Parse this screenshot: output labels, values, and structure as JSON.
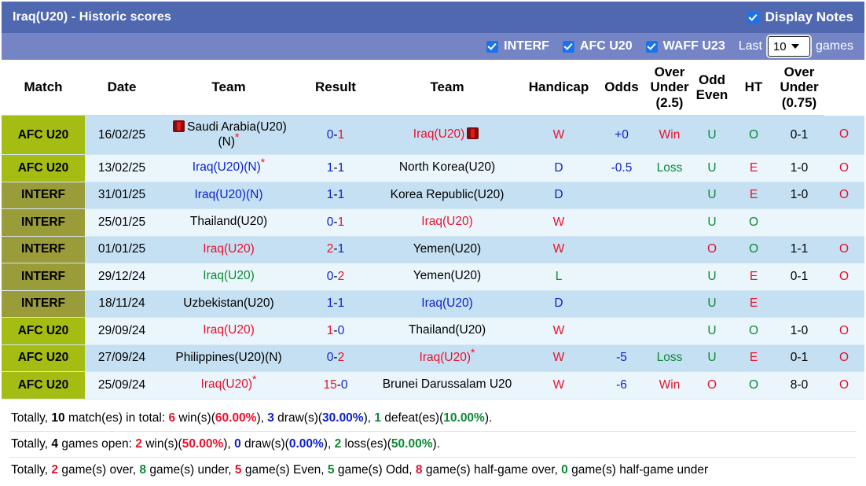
{
  "header": {
    "title": "Iraq(U20) - Historic scores",
    "display_notes_label": "Display Notes"
  },
  "filters": {
    "items": [
      {
        "label": "INTERF",
        "checked": true
      },
      {
        "label": "AFC U20",
        "checked": true
      },
      {
        "label": "WAFF U23",
        "checked": true
      }
    ],
    "last_label": "Last",
    "count_value": "10",
    "games_label": "games"
  },
  "table": {
    "columns": [
      "Match",
      "Date",
      "Team",
      "Result",
      "Team",
      "Handicap",
      "Odds",
      "Over Under (2.5)",
      "Odd Even",
      "HT",
      "Over Under (0.75)"
    ],
    "col_over_under_25": [
      "Over",
      "Under",
      "(2.5)"
    ],
    "col_odd_even": [
      "Odd",
      "Even"
    ],
    "col_over_under_075": [
      "Over",
      "Under",
      "(0.75)"
    ],
    "rows": [
      {
        "league": "AFC U20",
        "league_type": "afc",
        "date": "16/02/25",
        "home": "Saudi Arabia(U20)(N)",
        "home_color": "black",
        "home_card": true,
        "home_star": true,
        "score_left": "0",
        "score_left_color": "blue",
        "score_right": "1",
        "score_right_color": "red",
        "away": "Iraq(U20)",
        "away_color": "red",
        "away_card": true,
        "away_star": false,
        "wdl": "W",
        "wdl_color": "red",
        "handicap": "+0",
        "handicap_color": "blue",
        "odds": "Win",
        "odds_color": "red",
        "ou25": "U",
        "ou25_color": "green",
        "oddeven": "O",
        "oddeven_color": "green",
        "ht": "0-1",
        "ou075": "O",
        "ou075_color": "red",
        "tall": true
      },
      {
        "league": "AFC U20",
        "league_type": "afc",
        "date": "13/02/25",
        "home": "Iraq(U20)(N)",
        "home_color": "blue",
        "home_card": false,
        "home_star": true,
        "score_left": "1",
        "score_left_color": "blue",
        "score_right": "1",
        "score_right_color": "blue",
        "away": "North Korea(U20)",
        "away_color": "black",
        "away_card": false,
        "away_star": false,
        "wdl": "D",
        "wdl_color": "blue",
        "handicap": "-0.5",
        "handicap_color": "blue",
        "odds": "Loss",
        "odds_color": "green",
        "ou25": "U",
        "ou25_color": "green",
        "oddeven": "E",
        "oddeven_color": "red",
        "ht": "1-0",
        "ou075": "O",
        "ou075_color": "red",
        "tall": false
      },
      {
        "league": "INTERF",
        "league_type": "intf",
        "date": "31/01/25",
        "home": "Iraq(U20)(N)",
        "home_color": "blue",
        "home_card": false,
        "home_star": false,
        "score_left": "1",
        "score_left_color": "blue",
        "score_right": "1",
        "score_right_color": "blue",
        "away": "Korea Republic(U20)",
        "away_color": "black",
        "away_card": false,
        "away_star": false,
        "wdl": "D",
        "wdl_color": "blue",
        "handicap": "",
        "handicap_color": "blue",
        "odds": "",
        "odds_color": "red",
        "ou25": "U",
        "ou25_color": "green",
        "oddeven": "E",
        "oddeven_color": "red",
        "ht": "1-0",
        "ou075": "O",
        "ou075_color": "red",
        "tall": false
      },
      {
        "league": "INTERF",
        "league_type": "intf",
        "date": "25/01/25",
        "home": "Thailand(U20)",
        "home_color": "black",
        "home_card": false,
        "home_star": false,
        "score_left": "0",
        "score_left_color": "blue",
        "score_right": "1",
        "score_right_color": "red",
        "away": "Iraq(U20)",
        "away_color": "red",
        "away_card": false,
        "away_star": false,
        "wdl": "W",
        "wdl_color": "red",
        "handicap": "",
        "handicap_color": "blue",
        "odds": "",
        "odds_color": "red",
        "ou25": "U",
        "ou25_color": "green",
        "oddeven": "O",
        "oddeven_color": "green",
        "ht": "",
        "ou075": "",
        "ou075_color": "red",
        "tall": false
      },
      {
        "league": "INTERF",
        "league_type": "intf",
        "date": "01/01/25",
        "home": "Iraq(U20)",
        "home_color": "red",
        "home_card": false,
        "home_star": false,
        "score_left": "2",
        "score_left_color": "red",
        "score_right": "1",
        "score_right_color": "blue",
        "away": "Yemen(U20)",
        "away_color": "black",
        "away_card": false,
        "away_star": false,
        "wdl": "W",
        "wdl_color": "red",
        "handicap": "",
        "handicap_color": "blue",
        "odds": "",
        "odds_color": "red",
        "ou25": "O",
        "ou25_color": "red",
        "oddeven": "O",
        "oddeven_color": "green",
        "ht": "1-1",
        "ou075": "O",
        "ou075_color": "red",
        "tall": false
      },
      {
        "league": "INTERF",
        "league_type": "intf",
        "date": "29/12/24",
        "home": "Iraq(U20)",
        "home_color": "green",
        "home_card": false,
        "home_star": false,
        "score_left": "0",
        "score_left_color": "blue",
        "score_right": "2",
        "score_right_color": "red",
        "away": "Yemen(U20)",
        "away_color": "black",
        "away_card": false,
        "away_star": false,
        "wdl": "L",
        "wdl_color": "green",
        "handicap": "",
        "handicap_color": "blue",
        "odds": "",
        "odds_color": "red",
        "ou25": "U",
        "ou25_color": "green",
        "oddeven": "E",
        "oddeven_color": "red",
        "ht": "0-1",
        "ou075": "O",
        "ou075_color": "red",
        "tall": false
      },
      {
        "league": "INTERF",
        "league_type": "intf",
        "date": "18/11/24",
        "home": "Uzbekistan(U20)",
        "home_color": "black",
        "home_card": false,
        "home_star": false,
        "score_left": "1",
        "score_left_color": "blue",
        "score_right": "1",
        "score_right_color": "blue",
        "away": "Iraq(U20)",
        "away_color": "blue",
        "away_card": false,
        "away_star": false,
        "wdl": "D",
        "wdl_color": "blue",
        "handicap": "",
        "handicap_color": "blue",
        "odds": "",
        "odds_color": "red",
        "ou25": "U",
        "ou25_color": "green",
        "oddeven": "E",
        "oddeven_color": "red",
        "ht": "",
        "ou075": "",
        "ou075_color": "red",
        "tall": false
      },
      {
        "league": "AFC U20",
        "league_type": "afc",
        "date": "29/09/24",
        "home": "Iraq(U20)",
        "home_color": "red",
        "home_card": false,
        "home_star": false,
        "score_left": "1",
        "score_left_color": "red",
        "score_right": "0",
        "score_right_color": "blue",
        "away": "Thailand(U20)",
        "away_color": "black",
        "away_card": false,
        "away_star": false,
        "wdl": "W",
        "wdl_color": "red",
        "handicap": "",
        "handicap_color": "blue",
        "odds": "",
        "odds_color": "red",
        "ou25": "U",
        "ou25_color": "green",
        "oddeven": "O",
        "oddeven_color": "green",
        "ht": "1-0",
        "ou075": "O",
        "ou075_color": "red",
        "tall": false
      },
      {
        "league": "AFC U20",
        "league_type": "afc",
        "date": "27/09/24",
        "home": "Philippines(U20)(N)",
        "home_color": "black",
        "home_card": false,
        "home_star": false,
        "score_left": "0",
        "score_left_color": "blue",
        "score_right": "2",
        "score_right_color": "red",
        "away": "Iraq(U20)",
        "away_color": "red",
        "away_card": false,
        "away_star": true,
        "wdl": "W",
        "wdl_color": "red",
        "handicap": "-5",
        "handicap_color": "blue",
        "odds": "Loss",
        "odds_color": "green",
        "ou25": "U",
        "ou25_color": "green",
        "oddeven": "E",
        "oddeven_color": "red",
        "ht": "0-1",
        "ou075": "O",
        "ou075_color": "red",
        "tall": false
      },
      {
        "league": "AFC U20",
        "league_type": "afc",
        "date": "25/09/24",
        "home": "Iraq(U20)",
        "home_color": "red",
        "home_card": false,
        "home_star": true,
        "score_left": "15",
        "score_left_color": "red",
        "score_right": "0",
        "score_right_color": "blue",
        "away": "Brunei Darussalam U20",
        "away_color": "black",
        "away_card": false,
        "away_star": false,
        "wdl": "W",
        "wdl_color": "red",
        "handicap": "-6",
        "handicap_color": "blue",
        "odds": "Win",
        "odds_color": "red",
        "ou25": "O",
        "ou25_color": "red",
        "oddeven": "O",
        "oddeven_color": "green",
        "ht": "8-0",
        "ou075": "O",
        "ou075_color": "red",
        "tall": false
      }
    ]
  },
  "summary": {
    "line1": {
      "prefix": "Totally, ",
      "total": "10",
      "t1": " match(es) in total: ",
      "wins": "6",
      "t2": " win(s)(",
      "win_pct": "60.00%",
      "t3": "), ",
      "draws": "3",
      "t4": " draw(s)(",
      "draw_pct": "30.00%",
      "t5": "), ",
      "defeats": "1",
      "t6": " defeat(es)(",
      "defeat_pct": "10.00%",
      "t7": ")."
    },
    "line2": {
      "prefix": "Totally, ",
      "open": "4",
      "t1": " games open: ",
      "wins": "2",
      "t2": " win(s)(",
      "win_pct": "50.00%",
      "t3": "), ",
      "draws": "0",
      "t4": " draw(s)(",
      "draw_pct": "0.00%",
      "t5": "), ",
      "losses": "2",
      "t6": " loss(es)(",
      "loss_pct": "50.00%",
      "t7": ")."
    },
    "line3": {
      "prefix": "Totally, ",
      "over": "2",
      "t1": " game(s) over, ",
      "under": "8",
      "t2": " game(s) under, ",
      "even": "5",
      "t3": " game(s) Even, ",
      "odd": "5",
      "t4": " game(s) Odd, ",
      "half_over": "8",
      "t5": " game(s) half-game over, ",
      "half_under": "0",
      "t6": " game(s) half-game under"
    }
  },
  "colors": {
    "titlebar": "#5068b0",
    "filterbar": "#7484c4",
    "afc_green": "#a5bc13",
    "interf_olive": "#9a9c3a",
    "row_even": "#c5e0f2",
    "row_odd": "#eaf6fc",
    "red": "#e8112d",
    "blue": "#0b1fd0",
    "green": "#0a8a32"
  }
}
